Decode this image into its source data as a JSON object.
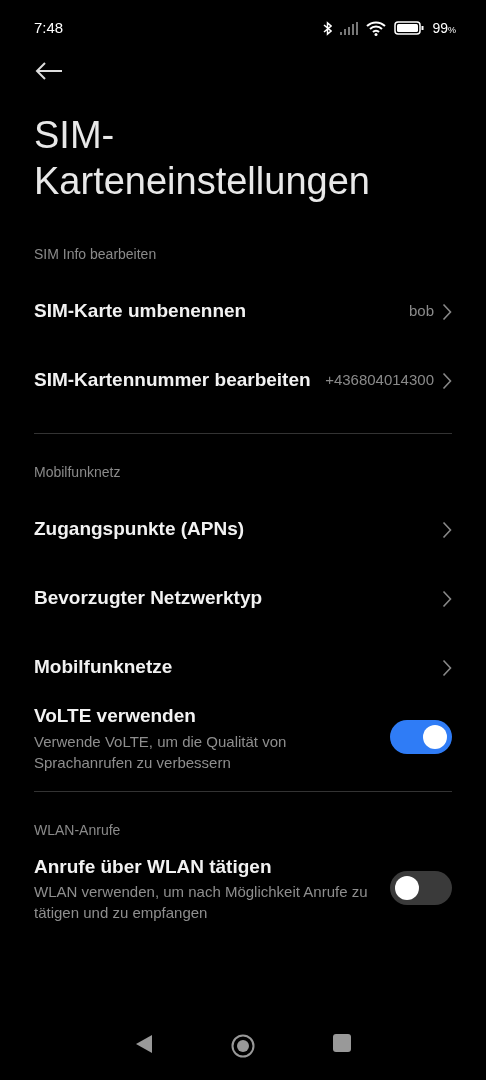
{
  "status_bar": {
    "time": "7:48",
    "battery": "99",
    "battery_unit": "%"
  },
  "title": "SIM-Karteneinstellungen",
  "sections": [
    {
      "header": "SIM Info bearbeiten",
      "items": [
        {
          "kind": "link",
          "title": "SIM-Karte umbenennen",
          "value": "bob"
        },
        {
          "kind": "link",
          "title": "SIM-Kartennummer bearbeiten",
          "value": "+436804014300"
        }
      ]
    },
    {
      "header": "Mobilfunknetz",
      "items": [
        {
          "kind": "link",
          "title": "Zugangspunkte (APNs)"
        },
        {
          "kind": "link",
          "title": "Bevorzugter Netzwerktyp"
        },
        {
          "kind": "link",
          "title": "Mobilfunknetze"
        },
        {
          "kind": "toggle",
          "title": "VoLTE verwenden",
          "description": "Verwende VoLTE, um die Qualität von Sprachanrufen zu verbessern",
          "on": true
        }
      ]
    },
    {
      "header": "WLAN-Anrufe",
      "items": [
        {
          "kind": "toggle",
          "title": "Anrufe über WLAN tätigen",
          "description": "WLAN verwenden, um nach Möglichkeit Anrufe zu tätigen und zu empfangen",
          "on": false
        }
      ]
    }
  ]
}
